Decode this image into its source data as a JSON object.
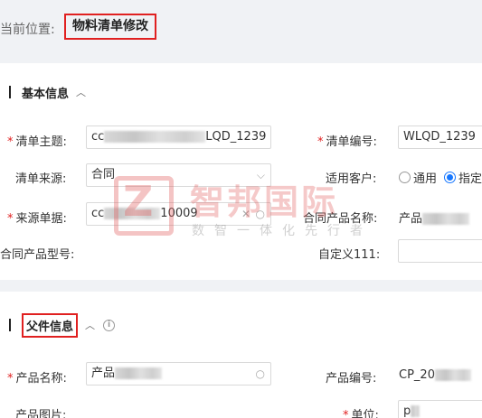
{
  "breadcrumb": {
    "label": "当前位置:",
    "current": "物料清单修改"
  },
  "section_basic": {
    "title": "基本信息",
    "chevron": "︿"
  },
  "fields": {
    "list_subject": {
      "label": "清单主题:",
      "value_prefix": "cc",
      "value_suffix": "LQD_1239"
    },
    "list_number": {
      "label": "清单编号:",
      "value": "WLQD_1239"
    },
    "list_source": {
      "label": "清单来源:",
      "value": "合同"
    },
    "customer": {
      "label": "适用客户:",
      "options": [
        "通用",
        "指定"
      ],
      "selected": "指定"
    },
    "source_doc": {
      "label": "来源单据:",
      "value_prefix": "cc",
      "value_suffix": "10009"
    },
    "contract_product_name": {
      "label": "合同产品名称:",
      "value_prefix": "产品"
    },
    "contract_product_model": {
      "label": "合同产品型号:"
    },
    "custom111": {
      "label": "自定义111:",
      "value": ""
    }
  },
  "section_parent": {
    "title": "父件信息",
    "chevron": "︿",
    "info": "i"
  },
  "parent_fields": {
    "product_name": {
      "label": "产品名称:",
      "value_prefix": "产品"
    },
    "product_number": {
      "label": "产品编号:",
      "value_prefix": "CP_20"
    },
    "product_image": {
      "label": "产品图片:"
    },
    "unit": {
      "label": "单位:",
      "value_prefix": "p"
    }
  },
  "watermark": {
    "logo_letter": "Z",
    "title": "智邦国际",
    "subtitle": "数智一体化先行者"
  },
  "icons": {
    "search": "search-icon",
    "clear": "close-icon",
    "dropdown": "chevron-down-icon"
  },
  "colors": {
    "accent": "#1677ff",
    "required": "#e02020",
    "highlight_box": "#e02020"
  }
}
